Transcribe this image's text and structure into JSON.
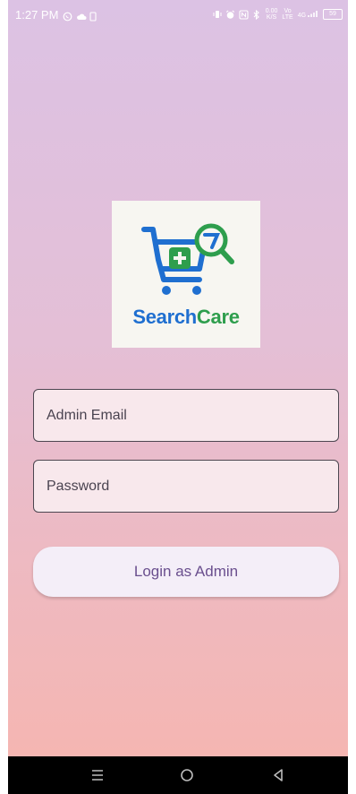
{
  "status_bar": {
    "time": "1:27 PM",
    "left_icons": [
      "whatsapp-icon",
      "cloud-icon",
      "sim-card-icon"
    ],
    "right_icons": [
      "vibrate-icon",
      "alarm-icon",
      "nfc-icon",
      "bluetooth-icon"
    ],
    "speed": "0.00",
    "speed_unit": "K/S",
    "volte": "Vo",
    "lte": "LTE",
    "network": "4G",
    "battery": "59"
  },
  "logo": {
    "brand_part1": "Search",
    "brand_part2": "Care",
    "colors": {
      "blue": "#1f6fd0",
      "green": "#2e9e4d"
    }
  },
  "form": {
    "email_placeholder": "Admin Email",
    "password_placeholder": "Password",
    "login_label": "Login as Admin"
  },
  "nav": {
    "icons": [
      "menu-icon",
      "home-icon",
      "back-icon"
    ]
  }
}
